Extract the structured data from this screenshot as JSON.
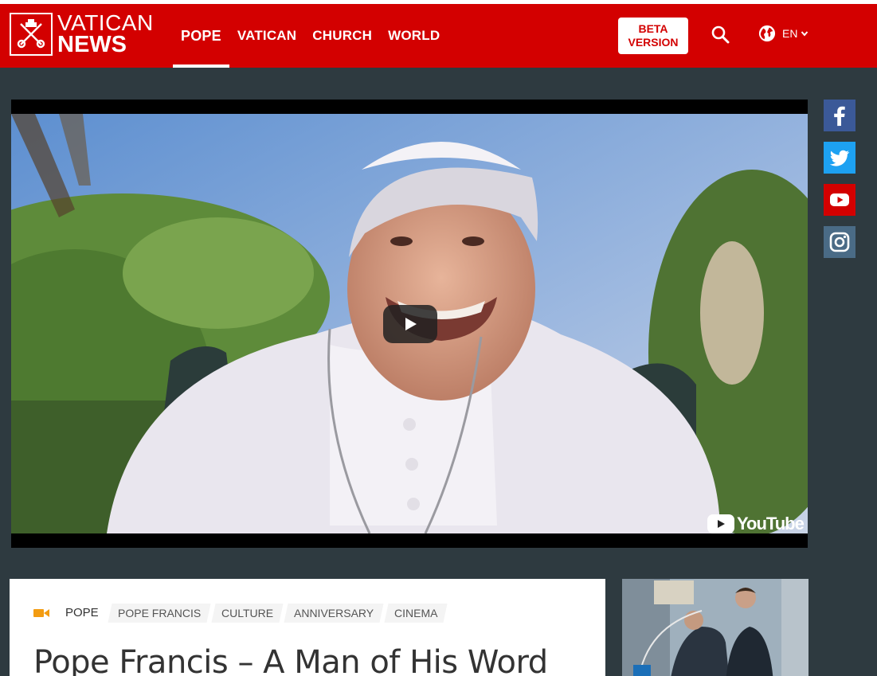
{
  "header": {
    "logo_icon": "vatican-keys-icon",
    "brand_top": "VATICAN",
    "brand_bottom": "NEWS",
    "nav": [
      {
        "label": "POPE",
        "active": true
      },
      {
        "label": "VATICAN"
      },
      {
        "label": "CHURCH"
      },
      {
        "label": "WORLD"
      }
    ],
    "beta_line1": "BETA",
    "beta_line2": "VERSION",
    "language": "EN",
    "accent_color": "#d30000"
  },
  "video": {
    "provider_label": "YouTube"
  },
  "social": [
    "facebook-icon",
    "twitter-icon",
    "youtube-icon",
    "instagram-icon"
  ],
  "article": {
    "media_icon": "video-camera-icon",
    "section": "POPE",
    "tags": [
      "POPE FRANCIS",
      "CULTURE",
      "ANNIVERSARY",
      "CINEMA"
    ],
    "title": "Pope Francis – A Man of His Word"
  }
}
